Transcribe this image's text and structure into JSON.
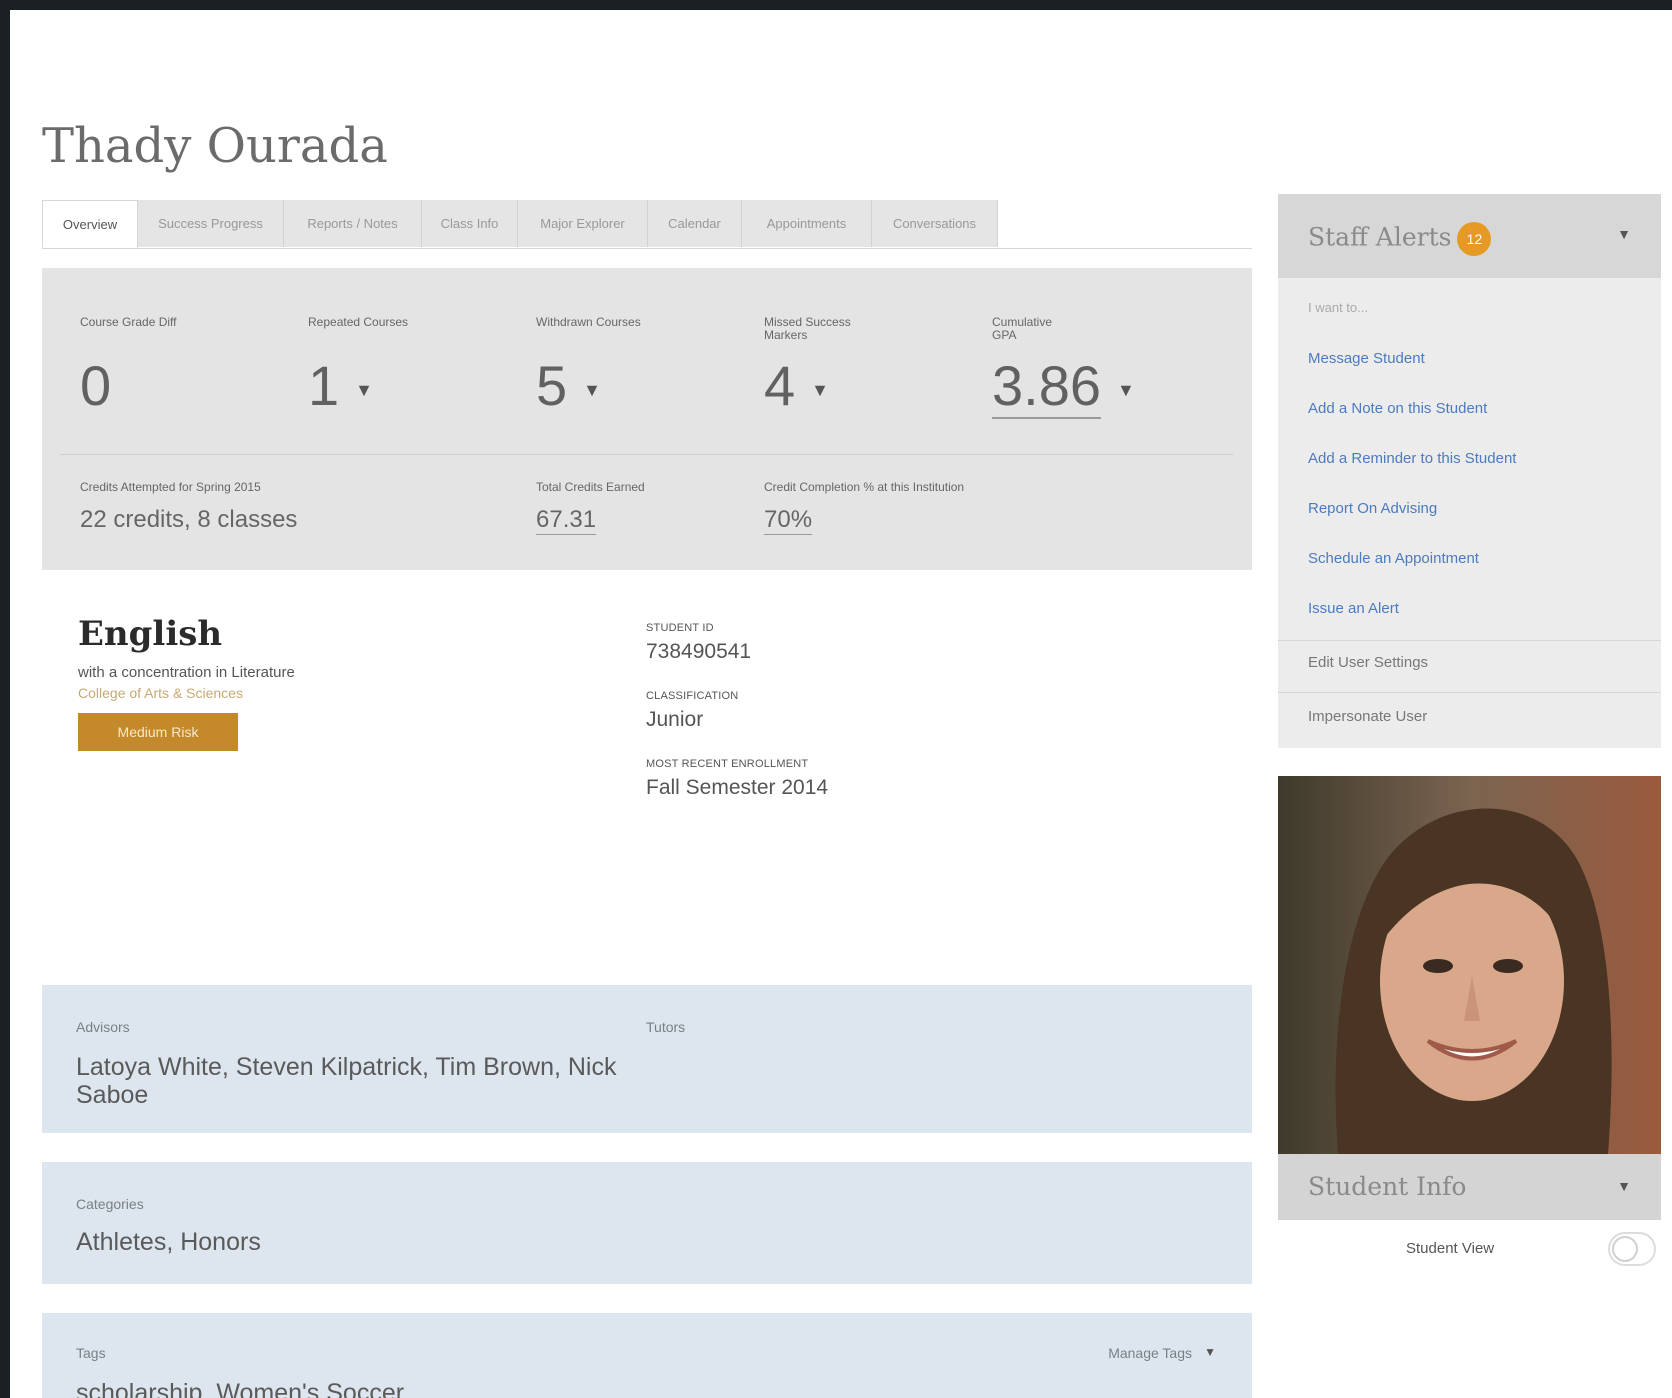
{
  "student": {
    "name": "Thady Ourada"
  },
  "tabs": [
    {
      "label": "Overview"
    },
    {
      "label": "Success Progress"
    },
    {
      "label": "Reports / Notes"
    },
    {
      "label": "Class Info"
    },
    {
      "label": "Major Explorer"
    },
    {
      "label": "Calendar"
    },
    {
      "label": "Appointments"
    },
    {
      "label": "Conversations"
    }
  ],
  "metrics": {
    "course_grade": {
      "label": "Course Grade Diff",
      "value": "0"
    },
    "repeated": {
      "label": "Repeated Courses",
      "value": "1"
    },
    "withdrawn": {
      "label": "Withdrawn Courses",
      "value": "5"
    },
    "missed": {
      "label": "Missed Success Markers",
      "value": "4"
    },
    "gpa": {
      "label": "Cumulative GPA",
      "value": "3.86"
    },
    "credits_attempted": {
      "label": "Credits Attempted for Spring 2015",
      "value": "22 credits, 8 classes"
    },
    "total_credits": {
      "label": "Total Credits Earned",
      "value": "67.31"
    },
    "completion": {
      "label": "Credit Completion % at this Institution",
      "value": "70%"
    }
  },
  "major": {
    "title": "English",
    "concentration": "with a concentration in Literature",
    "college": "College of Arts & Sciences",
    "risk": "Medium Risk"
  },
  "details": {
    "student_id_label": "Student ID",
    "student_id": "738490541",
    "classification_label": "Classification",
    "classification": "Junior",
    "enrollment_label": "Most Recent Enrollment",
    "enrollment": "Fall Semester 2014"
  },
  "advisors": {
    "label": "Advisors",
    "value": "Latoya White, Steven Kilpatrick, Tim Brown, Nick Saboe",
    "tutors_label": "Tutors"
  },
  "categories": {
    "label": "Categories",
    "value": "Athletes, Honors"
  },
  "tags": {
    "label": "Tags",
    "manage_label": "Manage Tags",
    "value": "scholarship, Women's Soccer"
  },
  "alerts": {
    "title": "Staff Alerts",
    "badge": "12",
    "prompt": "I want to...",
    "links": [
      "Message Student",
      "Add a Note on this Student",
      "Add a Reminder to this Student",
      "Report On Advising",
      "Schedule an Appointment",
      "Issue an Alert"
    ],
    "edit_settings": "Edit User Settings",
    "impersonate": "Impersonate User"
  },
  "student_info": {
    "title": "Student Info",
    "view_label": "Student View"
  },
  "icons": {
    "caret": "caret-down-icon"
  },
  "colors": {
    "risk": "#c4892a",
    "badge": "#e59a26",
    "link": "#4d7bbf",
    "panel": "#dde6ef"
  }
}
